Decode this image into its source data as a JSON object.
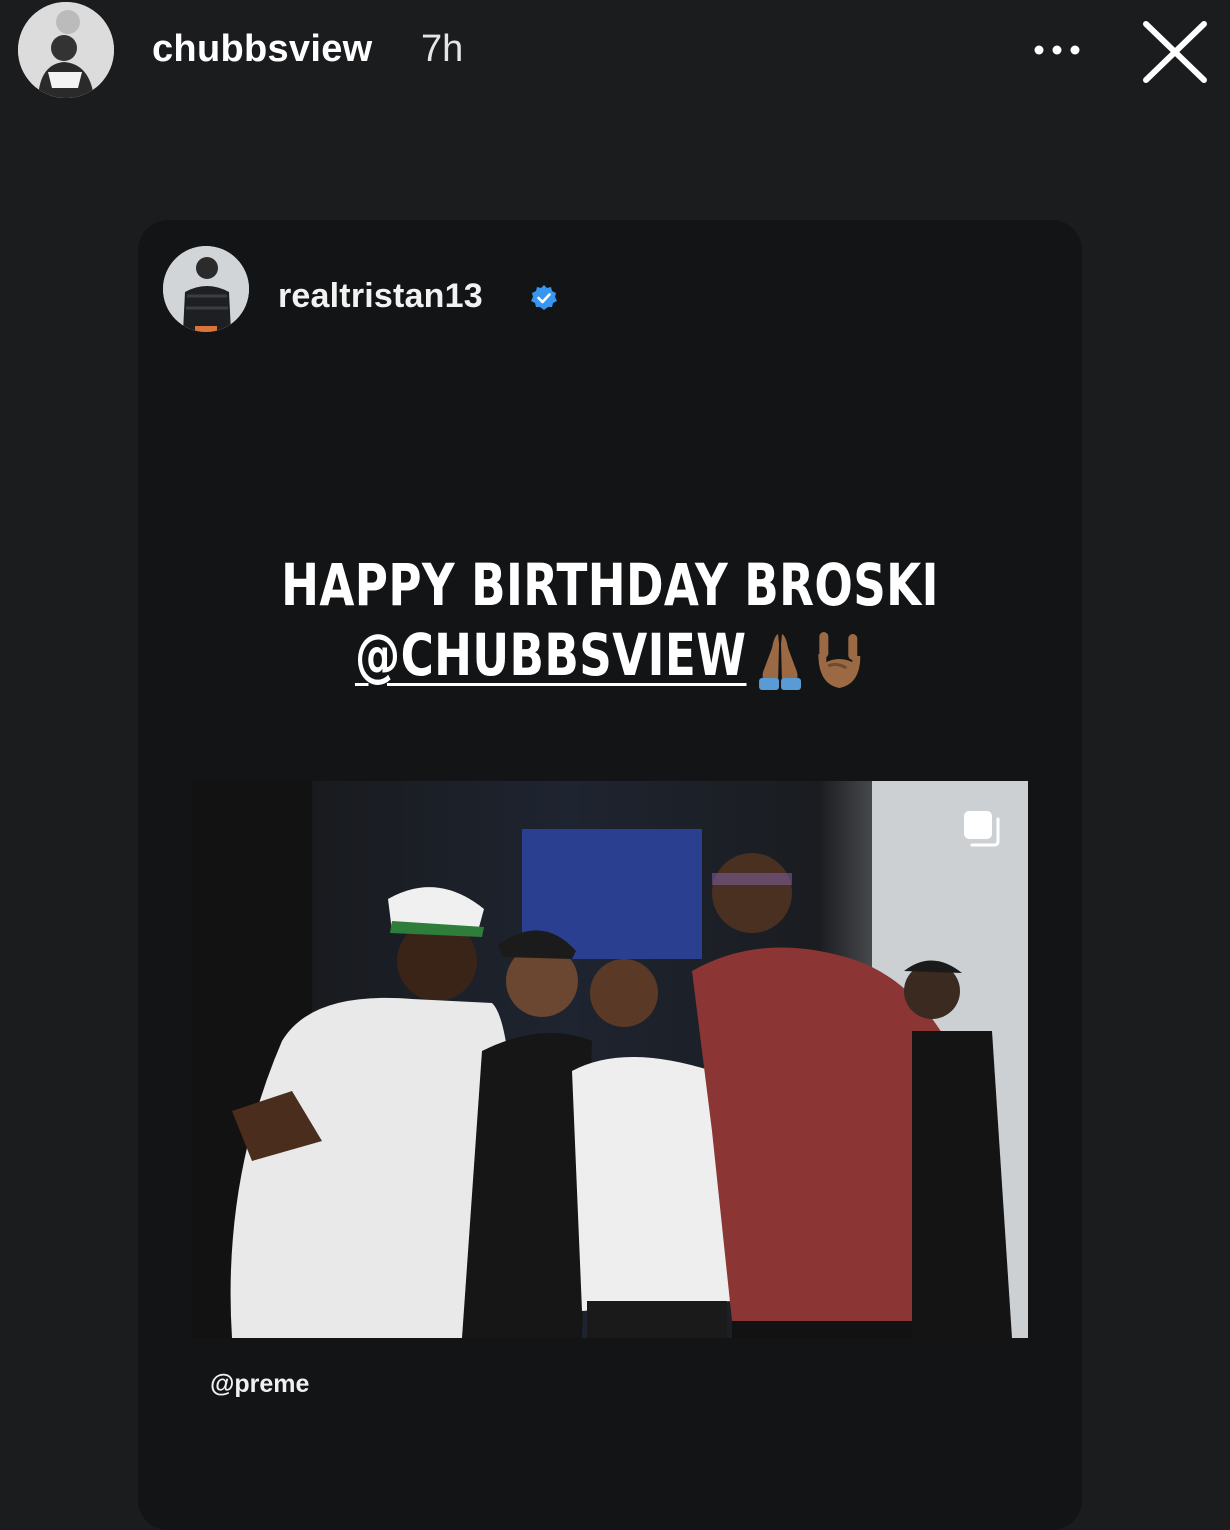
{
  "story": {
    "author": "chubbsview",
    "time": "7h"
  },
  "post": {
    "username": "realtristan13",
    "verified": true,
    "caption_line1": "HAPPY BIRTHDAY BROSKI",
    "caption_mention": "@CHUBBSVIEW",
    "emojis": [
      "folded-hands-emoji",
      "rock-on-hand-emoji"
    ],
    "photo_credit": "@preme"
  },
  "icons": {
    "more": "more-options-icon",
    "close": "close-icon",
    "verified": "verified-badge-icon",
    "multi": "multiple-photos-icon"
  },
  "colors": {
    "background": "#1b1c1e",
    "card": "#121416",
    "verified_blue": "#3797f0"
  }
}
